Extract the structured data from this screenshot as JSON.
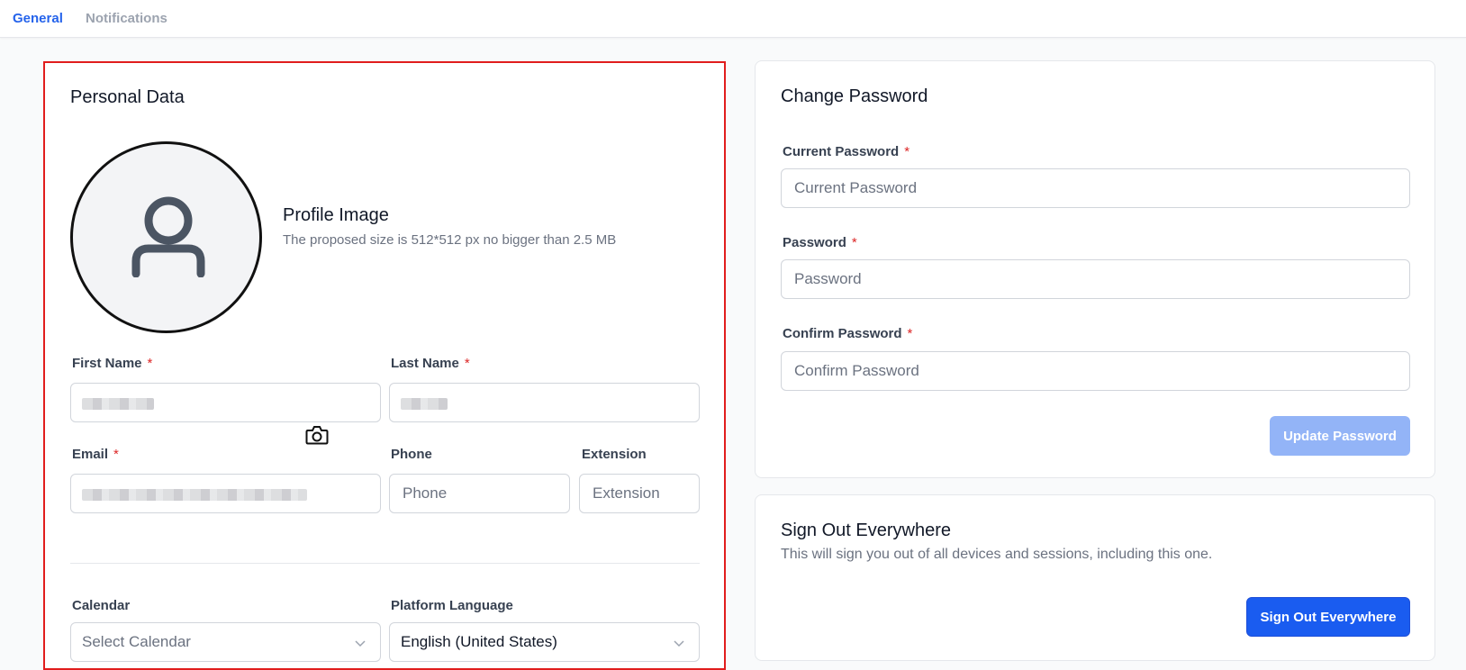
{
  "tabs": [
    {
      "label": "General",
      "active": true
    },
    {
      "label": "Notifications",
      "active": false
    }
  ],
  "personal": {
    "title": "Personal Data",
    "profile_image": {
      "title": "Profile Image",
      "hint": "The proposed size is 512*512 px no bigger than 2.5 MB",
      "icon": "user-icon",
      "camera_icon": "camera-icon"
    },
    "first_name": {
      "label": "First Name",
      "required": "*",
      "value": ""
    },
    "last_name": {
      "label": "Last Name",
      "required": "*",
      "value": ""
    },
    "email": {
      "label": "Email",
      "required": "*",
      "value": ""
    },
    "phone": {
      "label": "Phone",
      "placeholder": "Phone"
    },
    "extension": {
      "label": "Extension",
      "placeholder": "Extension"
    },
    "calendar": {
      "label": "Calendar",
      "value": "Select Calendar"
    },
    "language": {
      "label": "Platform Language",
      "value": "English (United States)"
    }
  },
  "password": {
    "title": "Change Password",
    "current": {
      "label": "Current Password",
      "required": "*",
      "placeholder": "Current Password"
    },
    "new": {
      "label": "Password",
      "required": "*",
      "placeholder": "Password"
    },
    "confirm": {
      "label": "Confirm Password",
      "required": "*",
      "placeholder": "Confirm Password"
    },
    "submit_label": "Update Password"
  },
  "signout": {
    "title": "Sign Out Everywhere",
    "description": "This will sign you out of all devices and sessions, including this one.",
    "button_label": "Sign Out Everywhere"
  },
  "colors": {
    "accent": "#2563eb",
    "required": "#dc2626",
    "highlight_border": "#e11d1d",
    "primary_button": "#1a5cf0",
    "disabled_button": "#93b4f7"
  }
}
